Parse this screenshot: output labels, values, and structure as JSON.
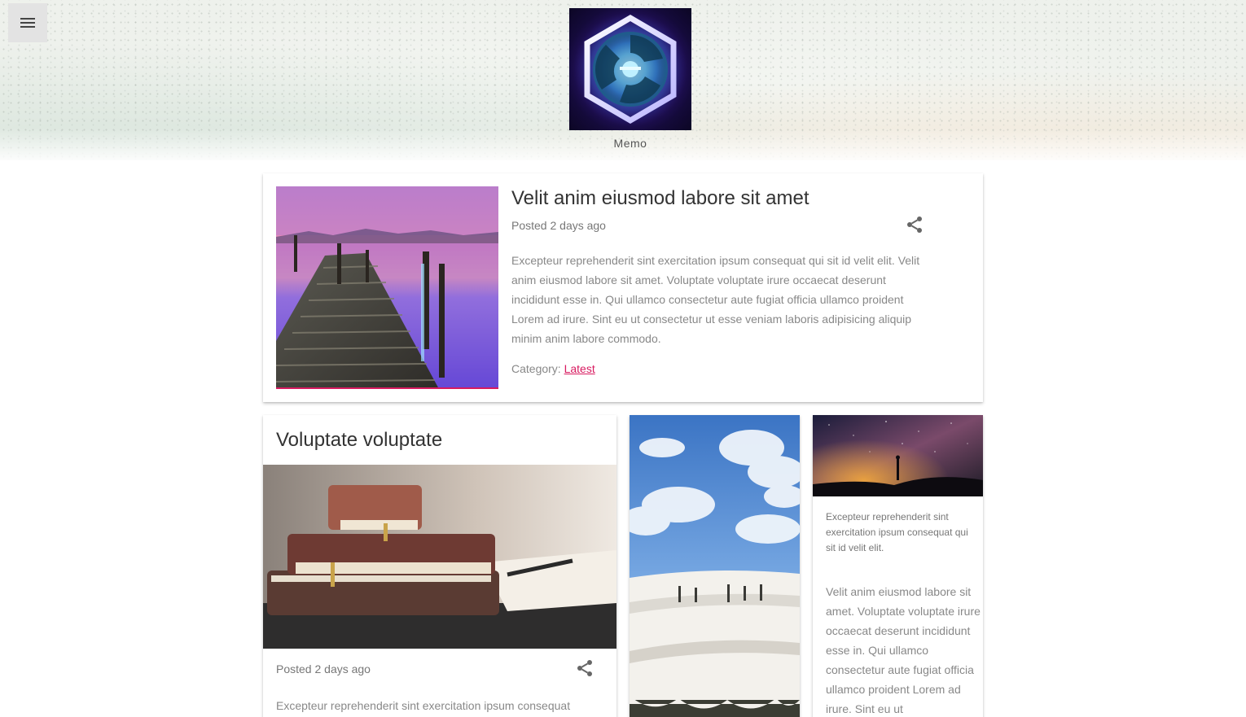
{
  "header": {
    "menu_icon": "hamburger-menu-icon",
    "logo_icon": "hexagon-swirl-logo",
    "site_name": "Memo"
  },
  "featured_post": {
    "title": "Velit anim eiusmod labore sit amet",
    "meta": "Posted 2 days ago",
    "share_icon": "share-icon",
    "excerpt": "Excepteur reprehenderit sint exercitation ipsum consequat qui sit id velit elit. Velit anim eiusmod labore sit amet. Voluptate voluptate irure occaecat deserunt incididunt esse in. Qui ullamco consectetur aute fugiat officia ullamco proident Lorem ad irure. Sint eu ut consectetur ut esse veniam laboris adipisicing aliquip minim anim labore commodo.",
    "category_label": "Category:",
    "category_link": "Latest",
    "accent_color": "#d81b60"
  },
  "cards": [
    {
      "title": "Voluptate voluptate",
      "meta": "Posted 2 days ago",
      "share_icon": "share-icon",
      "excerpt": "Excepteur reprehenderit sint exercitation ipsum consequat"
    },
    {
      "image": "sky-and-travertine-terraces"
    },
    {
      "image": "milky-way-night-sky",
      "small_text": "Excepteur reprehenderit sint exercitation ipsum consequat qui sit id velit elit.",
      "body_text": "Velit anim eiusmod labore sit amet. Voluptate voluptate irure occaecat deserunt incididunt esse in. Qui ullamco consectetur aute fugiat officia ullamco proident Lorem ad irure. Sint eu ut"
    }
  ]
}
